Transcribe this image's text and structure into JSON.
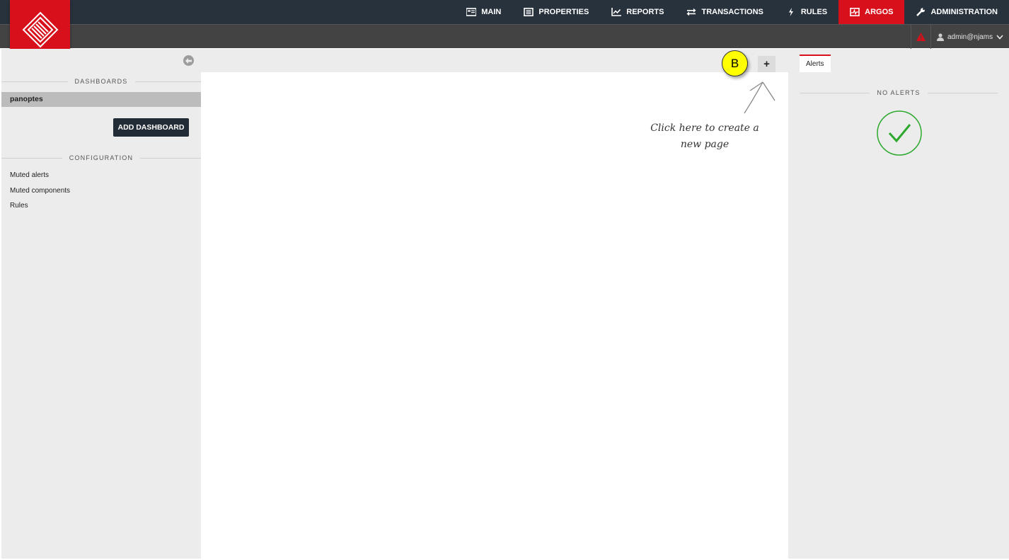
{
  "nav": {
    "items": [
      {
        "label": "MAIN",
        "icon": "main-icon"
      },
      {
        "label": "PROPERTIES",
        "icon": "properties-icon"
      },
      {
        "label": "REPORTS",
        "icon": "reports-icon"
      },
      {
        "label": "TRANSACTIONS",
        "icon": "transactions-icon"
      },
      {
        "label": "RULES",
        "icon": "rules-icon"
      },
      {
        "label": "ARGOS",
        "icon": "argos-icon",
        "active": true
      },
      {
        "label": "ADMINISTRATION",
        "icon": "administration-icon"
      }
    ],
    "active_color": "#d8101b"
  },
  "user": {
    "name": "admin@njams"
  },
  "sidebar": {
    "dashboards_heading": "DASHBOARDS",
    "dashboards": [
      "panoptes"
    ],
    "add_dashboard_label": "ADD DASHBOARD",
    "configuration_heading": "CONFIGURATION",
    "config_links": [
      "Muted alerts",
      "Muted components",
      "Rules"
    ]
  },
  "main": {
    "add_page_label": "+",
    "marker_label": "B",
    "hint_line1": "Click here to create a",
    "hint_line2": "new page"
  },
  "alerts_panel": {
    "tab_label": "Alerts",
    "status_heading": "NO ALERTS",
    "status_color": "#2ca82c"
  }
}
